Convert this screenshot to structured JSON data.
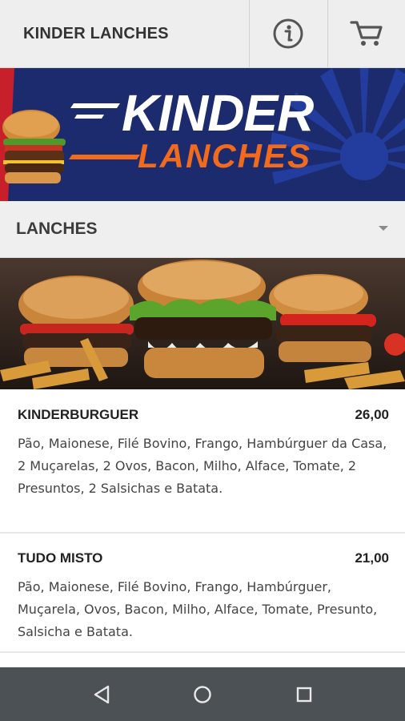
{
  "app_bar": {
    "title": "KINDER LANCHES",
    "info_icon": "info-icon",
    "cart_icon": "cart-icon"
  },
  "banner": {
    "logo_line1": "KINDER",
    "logo_line2": "LANCHES",
    "colors": {
      "background": "#1c2b6d",
      "accent": "#f26a1b",
      "text": "#ffffff"
    }
  },
  "category": {
    "name": "LANCHES",
    "dropdown_icon": "chevron-down-icon"
  },
  "menu": {
    "items": [
      {
        "name": "KINDERBURGUER",
        "price": "26,00",
        "description": "Pão, Maionese, Filé Bovino, Frango, Hambúrguer da Casa, 2 Muçarelas, 2 Ovos, Bacon, Milho, Alface, Tomate, 2 Presuntos, 2 Salsichas e Batata."
      },
      {
        "name": "TUDO MISTO",
        "price": "21,00",
        "description": "Pão, Maionese, Filé Bovino, Frango, Hambúrguer, Muçarela, Ovos, Bacon, Milho, Alface, Tomate, Presunto, Salsicha e Batata."
      }
    ]
  },
  "system_nav": {
    "back_icon": "back-icon",
    "home_icon": "home-icon",
    "recents_icon": "recents-icon"
  }
}
